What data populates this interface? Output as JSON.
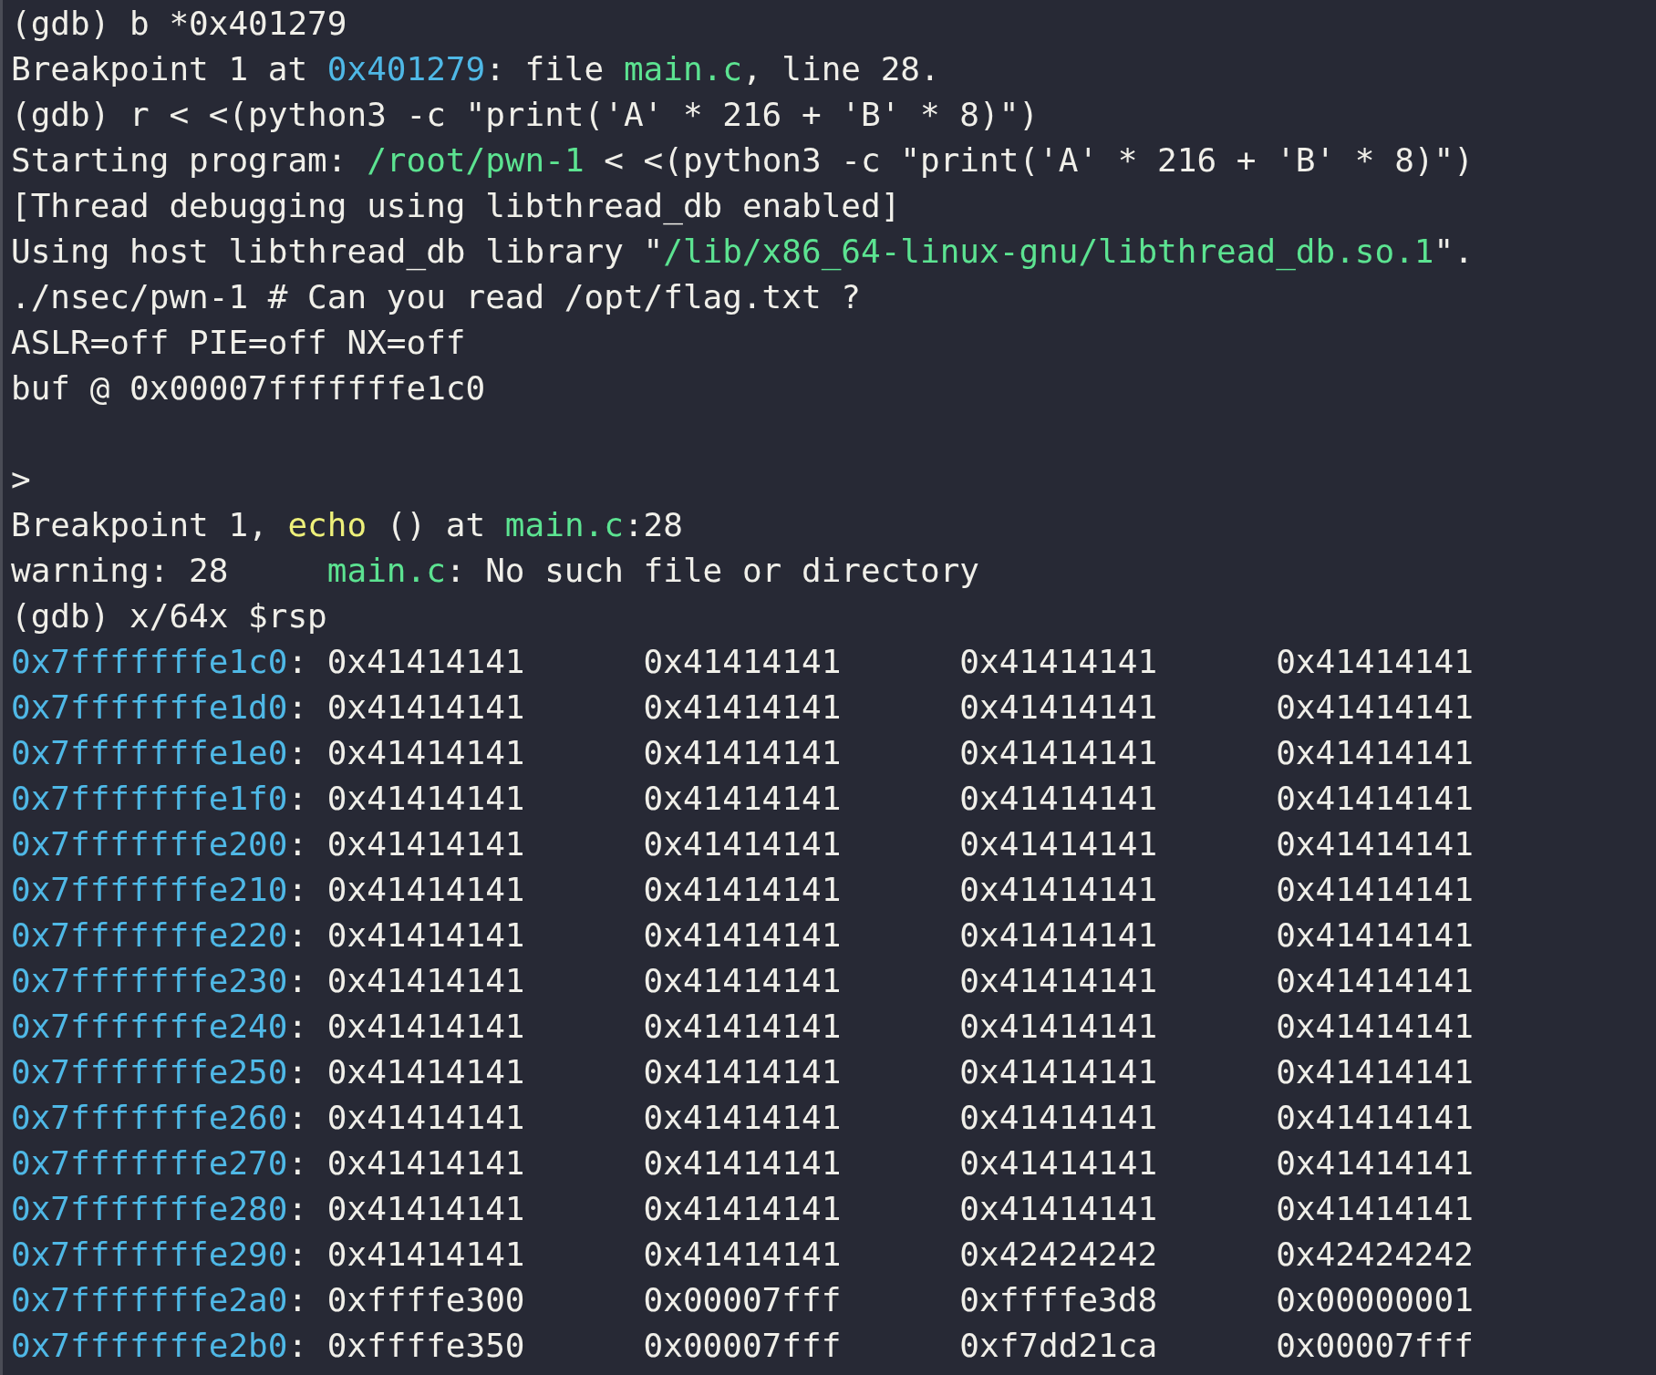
{
  "terminal": {
    "lines": [
      {
        "segments": [
          {
            "text": "(gdb) b *0x401279",
            "kind": "plain"
          }
        ]
      },
      {
        "segments": [
          {
            "text": "Breakpoint 1 at ",
            "kind": "plain"
          },
          {
            "text": "0x401279",
            "kind": "address"
          },
          {
            "text": ": file ",
            "kind": "plain"
          },
          {
            "text": "main.c",
            "kind": "path"
          },
          {
            "text": ", line 28.",
            "kind": "plain"
          }
        ]
      },
      {
        "segments": [
          {
            "text": "(gdb) r < <(python3 -c \"print('A' * 216 + 'B' * 8)\")",
            "kind": "plain"
          }
        ]
      },
      {
        "segments": [
          {
            "text": "Starting program: ",
            "kind": "plain"
          },
          {
            "text": "/root/pwn-1",
            "kind": "path"
          },
          {
            "text": " < <(python3 -c \"print('A' * 216 + 'B' * 8)\")",
            "kind": "plain"
          }
        ]
      },
      {
        "segments": [
          {
            "text": "[Thread debugging using libthread_db enabled]",
            "kind": "plain"
          }
        ]
      },
      {
        "segments": [
          {
            "text": "Using host libthread_db library \"",
            "kind": "plain"
          },
          {
            "text": "/lib/x86_64-linux-gnu/libthread_db.so.1",
            "kind": "path"
          },
          {
            "text": "\".",
            "kind": "plain"
          }
        ]
      },
      {
        "segments": [
          {
            "text": "./nsec/pwn-1 # Can you read /opt/flag.txt ?",
            "kind": "plain"
          }
        ]
      },
      {
        "segments": [
          {
            "text": "ASLR=off PIE=off NX=off",
            "kind": "plain"
          }
        ]
      },
      {
        "segments": [
          {
            "text": "buf @ 0x00007fffffffe1c0",
            "kind": "plain"
          }
        ]
      },
      {
        "segments": [
          {
            "text": "\n>",
            "kind": "plain"
          }
        ]
      },
      {
        "segments": [
          {
            "text": "Breakpoint 1, ",
            "kind": "plain"
          },
          {
            "text": "echo",
            "kind": "function"
          },
          {
            "text": " () at ",
            "kind": "plain"
          },
          {
            "text": "main.c",
            "kind": "path"
          },
          {
            "text": ":28",
            "kind": "plain"
          }
        ]
      },
      {
        "segments": [
          {
            "text": "warning: 28",
            "kind": "tabbed"
          },
          {
            "text": "main.c",
            "kind": "path"
          },
          {
            "text": ": No such file or directory",
            "kind": "plain"
          }
        ]
      },
      {
        "segments": [
          {
            "text": "(gdb) x/64x $rsp",
            "kind": "plain"
          }
        ]
      }
    ],
    "memory": [
      {
        "address": "0x7fffffffe1c0",
        "separator": ":",
        "values": [
          "0x41414141",
          "0x41414141",
          "0x41414141",
          "0x41414141"
        ]
      },
      {
        "address": "0x7fffffffe1d0",
        "separator": ":",
        "values": [
          "0x41414141",
          "0x41414141",
          "0x41414141",
          "0x41414141"
        ]
      },
      {
        "address": "0x7fffffffe1e0",
        "separator": ":",
        "values": [
          "0x41414141",
          "0x41414141",
          "0x41414141",
          "0x41414141"
        ]
      },
      {
        "address": "0x7fffffffe1f0",
        "separator": ":",
        "values": [
          "0x41414141",
          "0x41414141",
          "0x41414141",
          "0x41414141"
        ]
      },
      {
        "address": "0x7fffffffe200",
        "separator": ":",
        "values": [
          "0x41414141",
          "0x41414141",
          "0x41414141",
          "0x41414141"
        ]
      },
      {
        "address": "0x7fffffffe210",
        "separator": ":",
        "values": [
          "0x41414141",
          "0x41414141",
          "0x41414141",
          "0x41414141"
        ]
      },
      {
        "address": "0x7fffffffe220",
        "separator": ":",
        "values": [
          "0x41414141",
          "0x41414141",
          "0x41414141",
          "0x41414141"
        ]
      },
      {
        "address": "0x7fffffffe230",
        "separator": ":",
        "values": [
          "0x41414141",
          "0x41414141",
          "0x41414141",
          "0x41414141"
        ]
      },
      {
        "address": "0x7fffffffe240",
        "separator": ":",
        "values": [
          "0x41414141",
          "0x41414141",
          "0x41414141",
          "0x41414141"
        ]
      },
      {
        "address": "0x7fffffffe250",
        "separator": ":",
        "values": [
          "0x41414141",
          "0x41414141",
          "0x41414141",
          "0x41414141"
        ]
      },
      {
        "address": "0x7fffffffe260",
        "separator": ":",
        "values": [
          "0x41414141",
          "0x41414141",
          "0x41414141",
          "0x41414141"
        ]
      },
      {
        "address": "0x7fffffffe270",
        "separator": ":",
        "values": [
          "0x41414141",
          "0x41414141",
          "0x41414141",
          "0x41414141"
        ]
      },
      {
        "address": "0x7fffffffe280",
        "separator": ":",
        "values": [
          "0x41414141",
          "0x41414141",
          "0x41414141",
          "0x41414141"
        ]
      },
      {
        "address": "0x7fffffffe290",
        "separator": ":",
        "values": [
          "0x41414141",
          "0x41414141",
          "0x42424242",
          "0x42424242"
        ]
      },
      {
        "address": "0x7fffffffe2a0",
        "separator": ":",
        "values": [
          "0xffffe300",
          "0x00007fff",
          "0xffffe3d8",
          "0x00000001"
        ]
      },
      {
        "address": "0x7fffffffe2b0",
        "separator": ":",
        "values": [
          "0xffffe350",
          "0x00007fff",
          "0xf7dd21ca",
          "0x00007fff"
        ]
      }
    ]
  }
}
